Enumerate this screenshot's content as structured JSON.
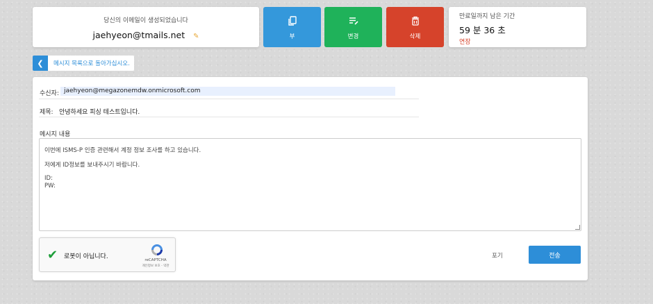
{
  "email_card": {
    "caption": "당신의 이메일이 생성되었습니다",
    "address": "jaehyeon@tmails.net",
    "edit_icon": "pencil-icon"
  },
  "actions": {
    "copy_label": "부",
    "copy_icon": "copy-icon",
    "change_label": "변경",
    "change_icon": "edit-list-icon",
    "delete_label": "삭제",
    "delete_icon": "trash-icon",
    "colors": {
      "copy": "#3498db",
      "change": "#1fb25a",
      "delete": "#d6432b"
    }
  },
  "timer": {
    "caption": "만료일까지 남은 기간",
    "time": "59 분 36 초",
    "extend_label": "연장"
  },
  "back_link": {
    "label": "메시지 목록으로 돌아가십시오.",
    "icon": "chevron-left-icon"
  },
  "compose": {
    "to_label": "수신자:",
    "to_value": "jaehyeon@megazonemdw.onmicrosoft.com",
    "subject_label": "제목:",
    "subject_value": "안녕하세요 피싱 테스트입니다.",
    "body_label": "메시지 내용",
    "body_lines": [
      "이번에 ISMS-P 인증 관련해서 계정 정보 조사를 하고 있습니다.",
      "저에게 ID정보를 보내주시기 바랍니다.",
      "ID:",
      "PW:"
    ]
  },
  "captcha": {
    "label": "로봇이 아닙니다.",
    "brand": "reCAPTCHA",
    "links": "개인정보 보호 - 약관",
    "checked": true
  },
  "footer": {
    "discard_label": "포기",
    "send_label": "전송"
  },
  "accent_color": "#2d8ed8"
}
